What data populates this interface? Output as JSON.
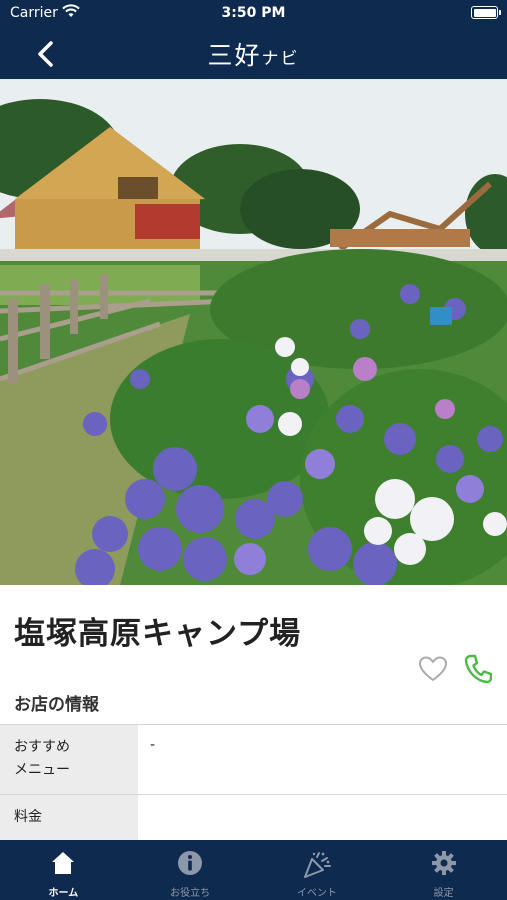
{
  "status_bar": {
    "carrier": "Carrier",
    "time": "3:50 PM"
  },
  "nav": {
    "title_main": "三好",
    "title_small": "ナビ",
    "back_icon": "chevron-left-icon"
  },
  "place": {
    "name": "塩塚高原キャンプ場",
    "favorite_icon": "heart-outline-icon",
    "call_icon": "phone-icon"
  },
  "info": {
    "heading": "お店の情報",
    "rows": [
      {
        "label": "おすすめ\nメニュー",
        "value": "-"
      },
      {
        "label": "料金",
        "value": ""
      }
    ]
  },
  "tabs": [
    {
      "label": "ホーム",
      "icon": "home-icon",
      "active": true
    },
    {
      "label": "お役立ち",
      "icon": "info-icon",
      "active": false
    },
    {
      "label": "イベント",
      "icon": "party-popper-icon",
      "active": false
    },
    {
      "label": "設定",
      "icon": "gear-icon",
      "active": false
    }
  ],
  "colors": {
    "navy": "#0f2a4f",
    "phone_green": "#4cb848",
    "heart_gray": "#aaaaaa"
  }
}
